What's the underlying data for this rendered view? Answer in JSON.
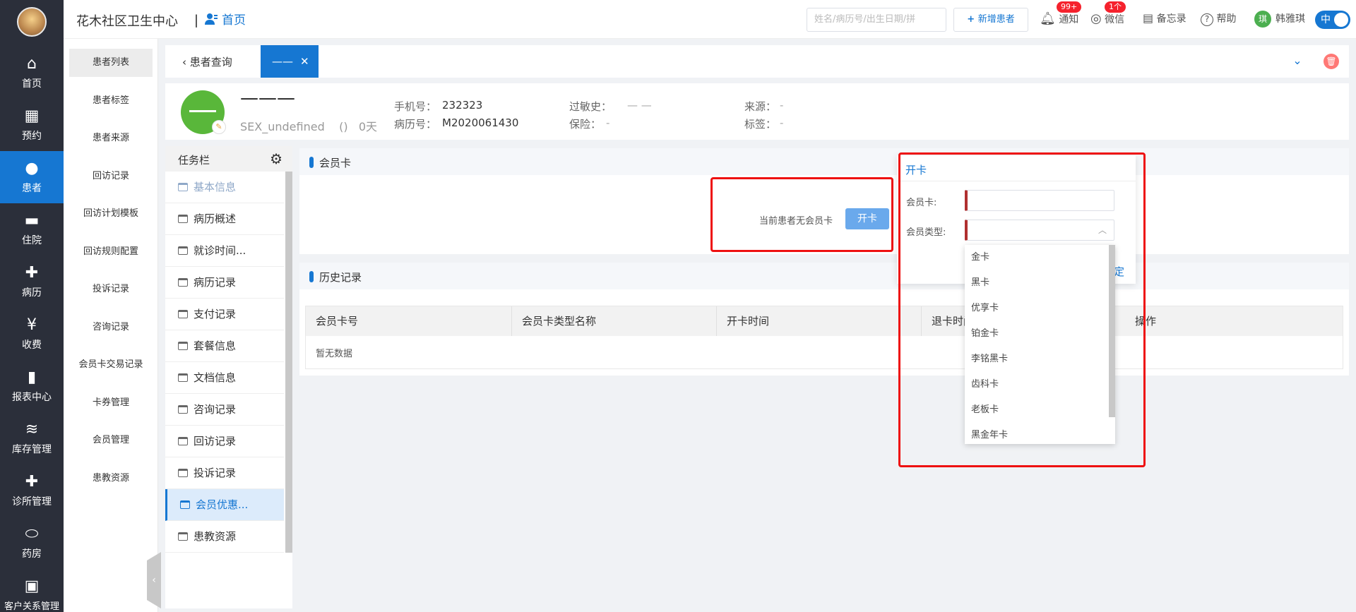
{
  "app": {
    "clinic_name": "花木社区卫生中心",
    "separator": "丨",
    "home_label": "首页"
  },
  "left_nav": [
    {
      "label": "首页",
      "icon": "home-icon",
      "glyph": "⌂"
    },
    {
      "label": "预约",
      "icon": "calendar-clock-icon",
      "glyph": "▦"
    },
    {
      "label": "患者",
      "icon": "patient-icon",
      "glyph": "●"
    },
    {
      "label": "住院",
      "icon": "bed-icon",
      "glyph": "▬"
    },
    {
      "label": "病历",
      "icon": "medical-record-icon",
      "glyph": "✚"
    },
    {
      "label": "收费",
      "icon": "money-bag-icon",
      "glyph": "¥"
    },
    {
      "label": "报表中心",
      "icon": "bar-chart-icon",
      "glyph": "▮"
    },
    {
      "label": "库存管理",
      "icon": "layers-icon",
      "glyph": "≋"
    },
    {
      "label": "诊所管理",
      "icon": "clinic-icon",
      "glyph": "✚"
    },
    {
      "label": "药房",
      "icon": "pill-icon",
      "glyph": "⬭"
    },
    {
      "label": "客户关系管理",
      "icon": "scrm-icon",
      "glyph": "▣"
    }
  ],
  "sub_nav": [
    "患者列表",
    "患者标签",
    "患者来源",
    "回访记录",
    "回访计划模板",
    "回访规则配置",
    "投诉记录",
    "咨询记录",
    "会员卡交易记录",
    "卡券管理",
    "会员管理",
    "患教资源"
  ],
  "header": {
    "search_placeholder": "姓名/病历号/出生日期/拼",
    "new_patient": "新增患者",
    "notify": "通知",
    "notify_badge": "99+",
    "wechat": "微信",
    "wechat_badge": "1个",
    "memo": "备忘录",
    "help": "帮助",
    "user_avatar": "琪",
    "user_name": "韩雅琪",
    "lang": "中"
  },
  "tabs": {
    "back_label": "患者查询",
    "active_label": "——"
  },
  "patient": {
    "name": "———",
    "sex": "SEX_undefined",
    "age_paren": "()",
    "days": "0天",
    "phone_label": "手机号：",
    "phone": "232323",
    "record_label": "病历号：",
    "record": "M2020061430",
    "allergy_label": "过敏史：",
    "allergy": "— —",
    "insurance_label": "保险：",
    "insurance": "-",
    "source_label": "来源：",
    "source": "-",
    "tag_label": "标签：",
    "tag": "-"
  },
  "task_panel": {
    "title": "任务栏",
    "items": [
      "基本信息",
      "病历概述",
      "就诊时间...",
      "病历记录",
      "支付记录",
      "套餐信息",
      "文档信息",
      "咨询记录",
      "回访记录",
      "投诉记录",
      "会员优惠...",
      "患教资源"
    ],
    "active_index": 10
  },
  "member_card": {
    "title": "会员卡",
    "no_card": "当前患者无会员卡",
    "open_button": "开卡"
  },
  "history": {
    "title": "历史记录",
    "columns": [
      "会员卡号",
      "会员卡类型名称",
      "开卡时间",
      "退卡时间",
      "",
      "操作"
    ],
    "empty": "暂无数据"
  },
  "open_card_popup": {
    "title": "开卡",
    "card_label": "会员卡:",
    "type_label": "会员类型:",
    "confirm_fragment": "定",
    "options": [
      "金卡",
      "黑卡",
      "优享卡",
      "铂金卡",
      "李铭黑卡",
      "齿科卡",
      "老板卡",
      "黑金年卡"
    ]
  },
  "colors": {
    "primary": "#1677d2",
    "nav_bg": "#2b2f3a",
    "highlight": "#ee1111",
    "avatar_green": "#59b73a"
  }
}
